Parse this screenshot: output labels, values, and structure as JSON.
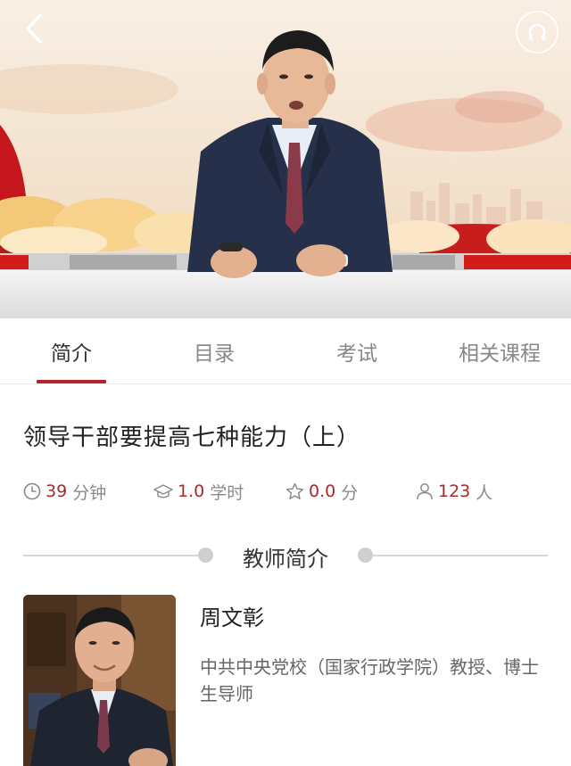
{
  "video": {
    "back_icon": "chevron-left-icon",
    "audio_icon": "headphones-icon"
  },
  "tabs": [
    {
      "label": "简介",
      "active": true
    },
    {
      "label": "目录",
      "active": false
    },
    {
      "label": "考试",
      "active": false
    },
    {
      "label": "相关课程",
      "active": false
    }
  ],
  "course": {
    "title": "领导干部要提高七种能力（上）",
    "stats": {
      "duration": {
        "icon": "clock-icon",
        "value": "39",
        "unit": "分钟"
      },
      "credit": {
        "icon": "graduation-cap-icon",
        "value": "1.0",
        "unit": "学时"
      },
      "rating": {
        "icon": "star-icon",
        "value": "0.0",
        "unit": "分"
      },
      "learners": {
        "icon": "person-icon",
        "value": "123",
        "unit": "人"
      }
    }
  },
  "teacher_section": {
    "heading": "教师简介",
    "name": "周文彰",
    "description": "中共中央党校（国家行政学院）教授、博士生导师"
  },
  "colors": {
    "accent": "#b0242b",
    "value_red": "#a72a2a",
    "muted_text": "#888888"
  }
}
